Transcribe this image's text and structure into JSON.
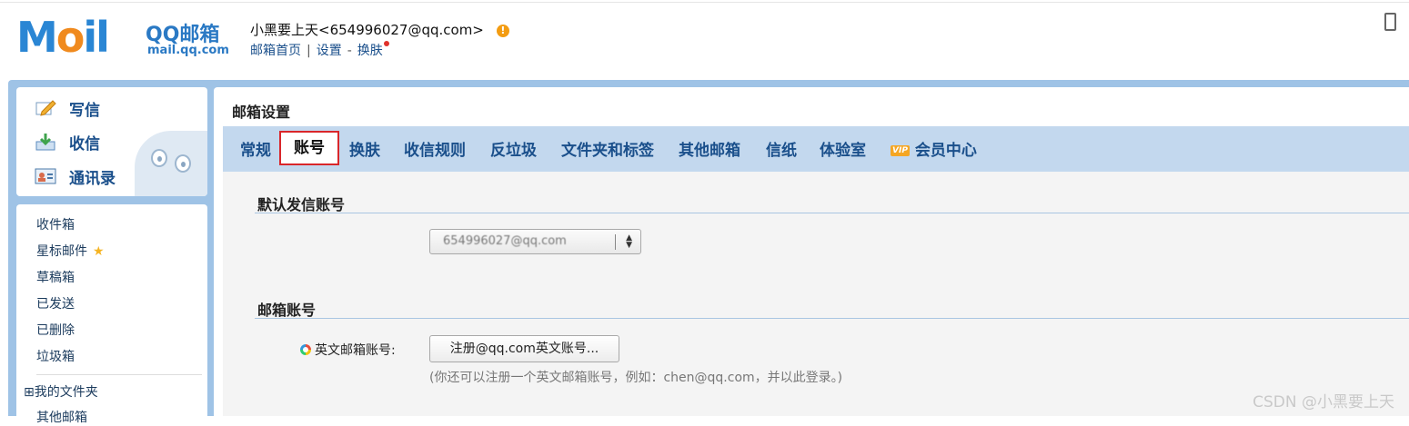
{
  "header": {
    "logo_text": "M",
    "logo_o": "o",
    "logo_il": "il",
    "brand": "QQ邮箱",
    "domain": "mail.qq.com",
    "user": "小黑要上天<654996027@qq.com>",
    "warn_icon": "!",
    "links": {
      "home": "邮箱首页",
      "sep1": "|",
      "settings": "设置",
      "sep2": "-",
      "skin": "换肤"
    }
  },
  "sidebar": {
    "compose": "写信",
    "inbox_check": "收信",
    "contacts": "通讯录",
    "folders": [
      {
        "label": "收件箱"
      },
      {
        "label": "星标邮件"
      },
      {
        "label": "草稿箱"
      },
      {
        "label": "已发送"
      },
      {
        "label": "已删除"
      },
      {
        "label": "垃圾箱"
      }
    ],
    "star_glyph": "★",
    "my_folders": "⊞我的文件夹",
    "other_mailbox": "其他邮箱"
  },
  "main": {
    "title": "邮箱设置",
    "tabs": [
      {
        "label": "常规"
      },
      {
        "label": "账号"
      },
      {
        "label": "换肤"
      },
      {
        "label": "收信规则"
      },
      {
        "label": "反垃圾"
      },
      {
        "label": "文件夹和标签"
      },
      {
        "label": "其他邮箱"
      },
      {
        "label": "信纸"
      },
      {
        "label": "体验室"
      },
      {
        "label": "会员中心"
      }
    ],
    "vip_badge": "VIP",
    "active_tab": "账号",
    "section_default_sender": "默认发信账号",
    "default_sender_value": "654996027@qq.com",
    "section_mail_account": "邮箱账号",
    "english_account_label": "英文邮箱账号:",
    "register_button": "注册@qq.com英文账号...",
    "register_hint": "(你还可以注册一个英文邮箱账号，例如：chen@qq.com，并以此登录。)"
  },
  "watermark": "CSDN @小黑要上天",
  "colors": {
    "accent": "#1a4f8b",
    "frame": "#9fc3e6",
    "tabbar": "#c3d8ee",
    "active_border": "#d9262a"
  }
}
